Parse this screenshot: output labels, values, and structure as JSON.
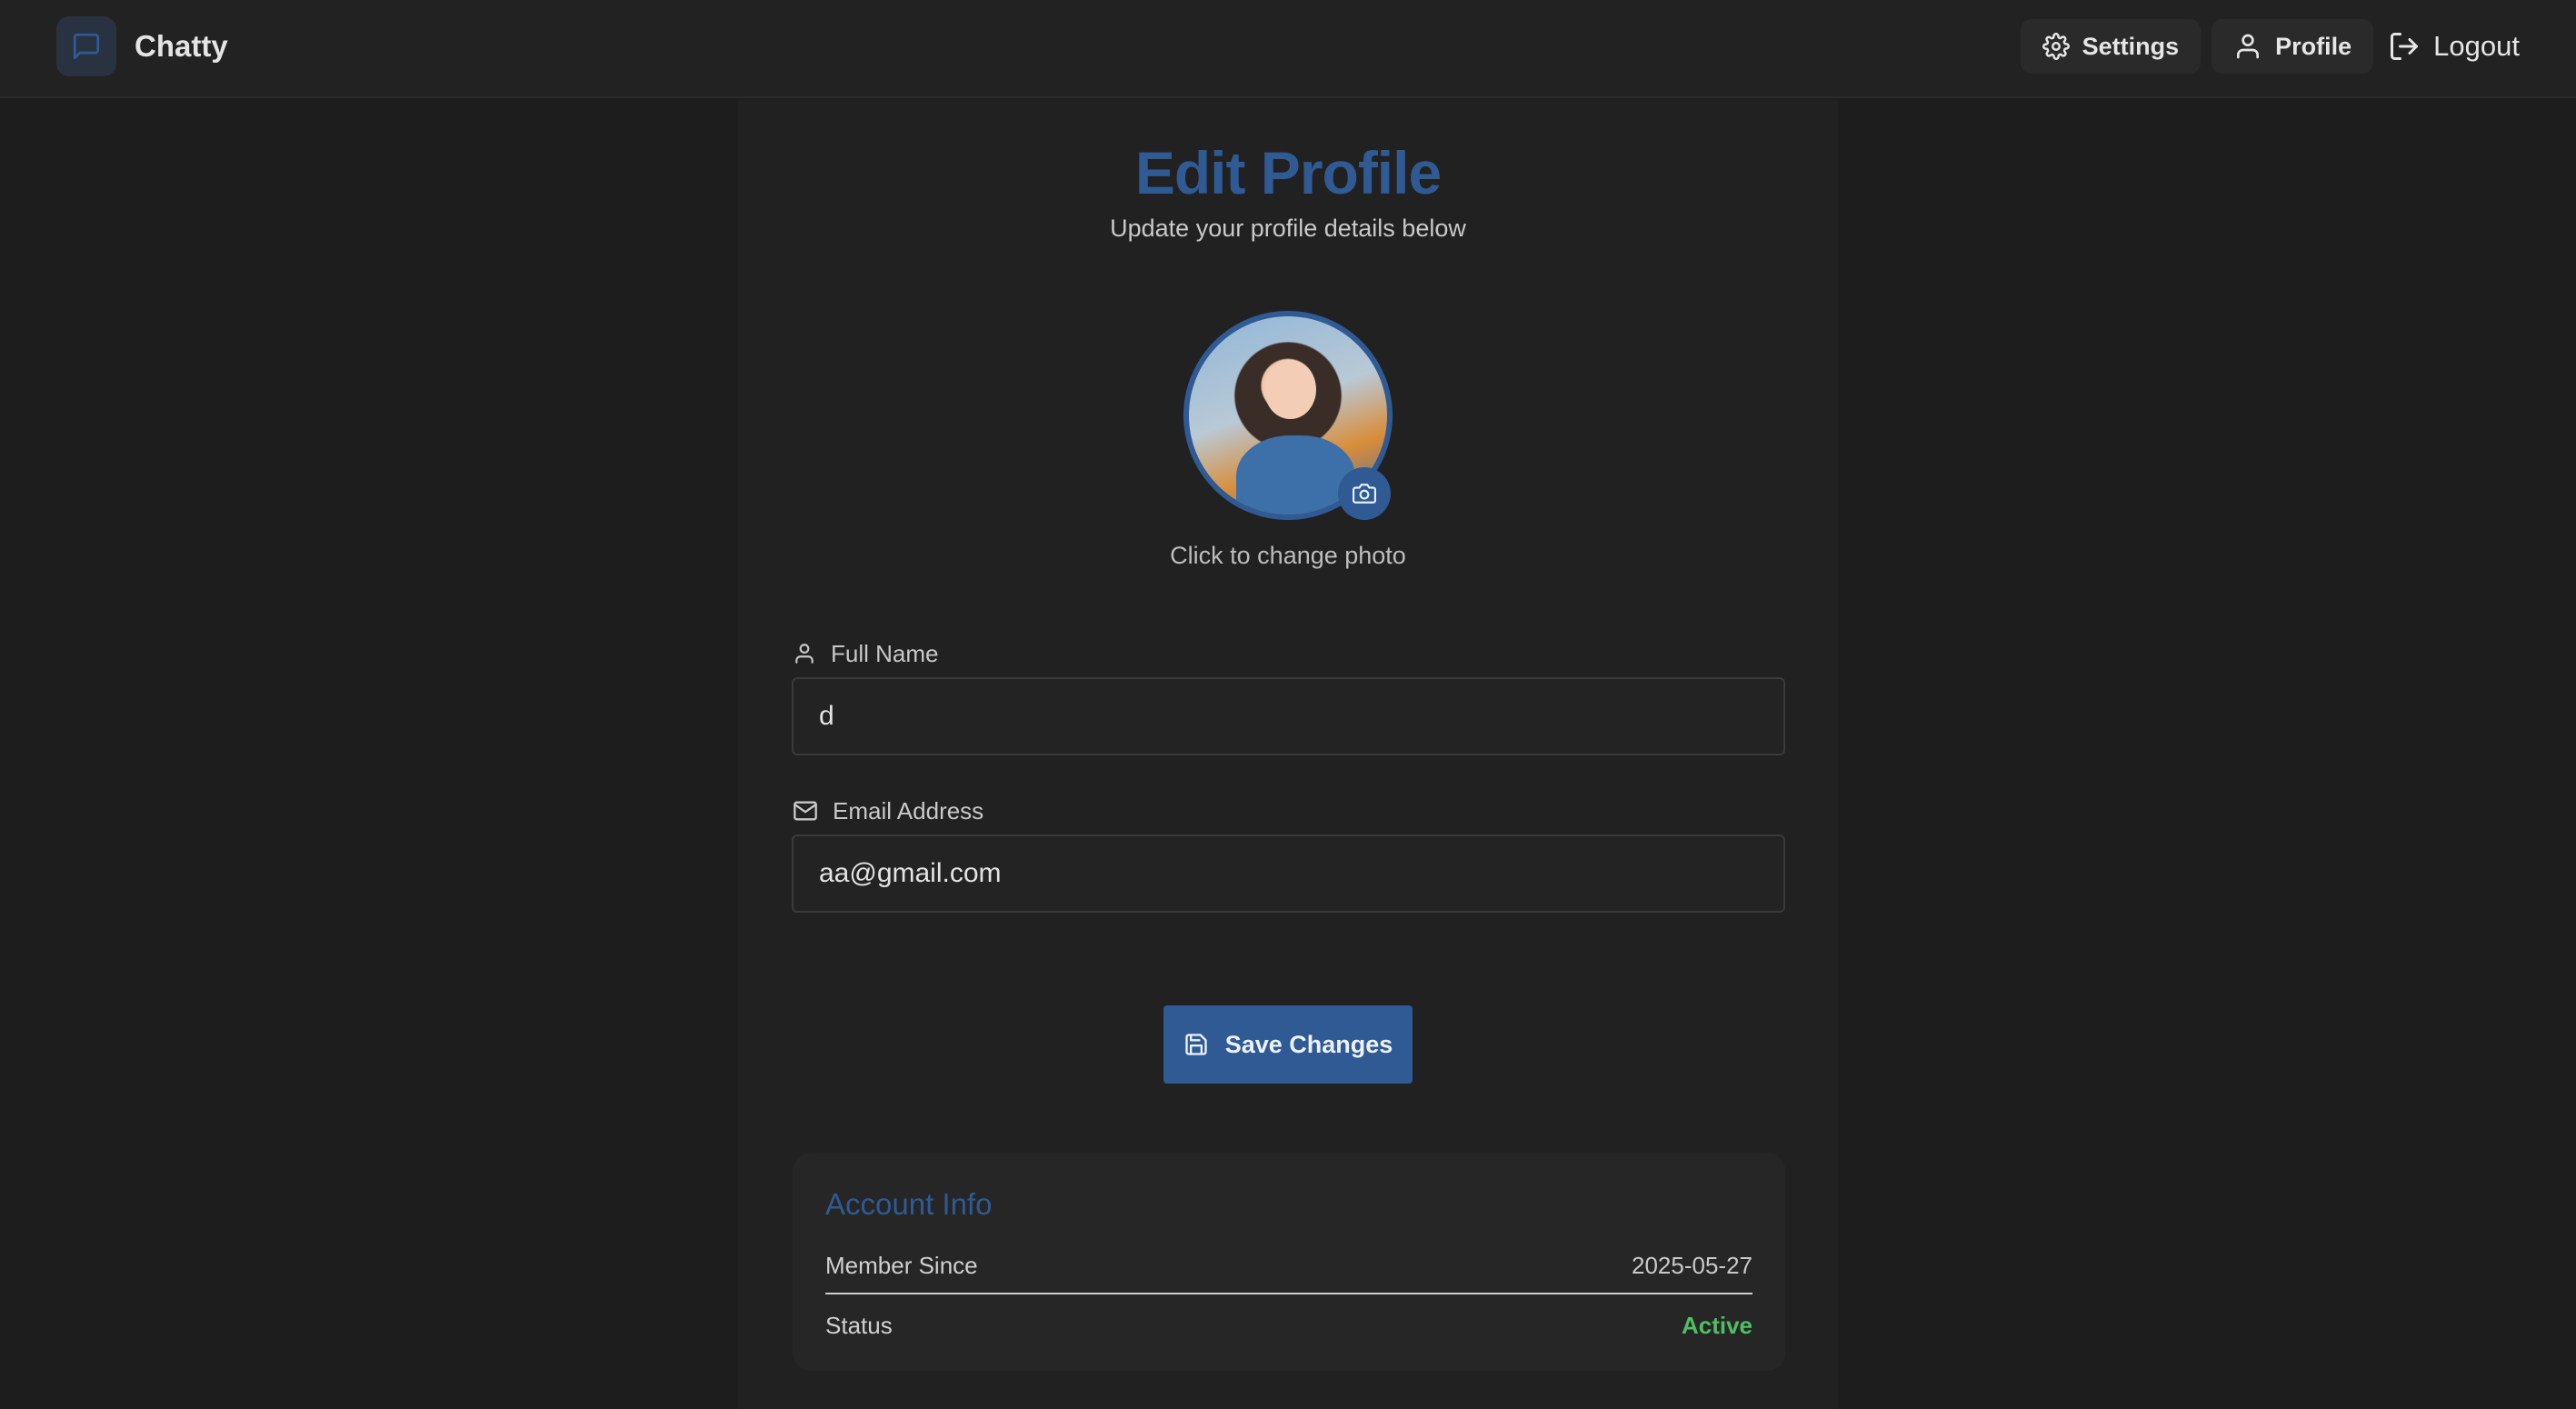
{
  "app": {
    "name": "Chatty"
  },
  "nav": {
    "settings_label": "Settings",
    "profile_label": "Profile",
    "logout_label": "Logout"
  },
  "page": {
    "title": "Edit Profile",
    "subtitle": "Update your profile details below",
    "photo_hint": "Click to change photo"
  },
  "form": {
    "full_name_label": "Full Name",
    "full_name_value": "d",
    "email_label": "Email Address",
    "email_value": "aa@gmail.com",
    "save_label": "Save Changes"
  },
  "account_info": {
    "title": "Account Info",
    "member_since_label": "Member Since",
    "member_since_value": "2025-05-27",
    "status_label": "Status",
    "status_value": "Active"
  },
  "colors": {
    "accent": "#2f5a94",
    "status_active": "#4fbf62",
    "background": "#1e1e1e"
  },
  "icons": {
    "brand": "chat-bubble-icon",
    "settings": "gear-icon",
    "profile": "user-icon",
    "logout": "logout-icon",
    "camera": "camera-icon",
    "full_name": "user-icon",
    "email": "mail-icon",
    "save": "floppy-disk-icon"
  }
}
